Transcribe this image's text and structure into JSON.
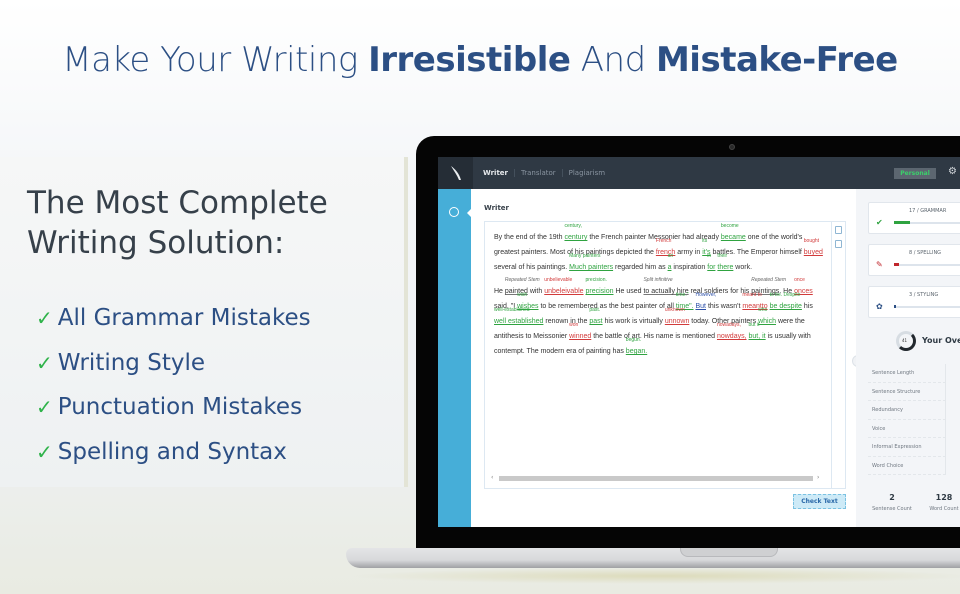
{
  "hero": {
    "headline_part1": "Make Your Writing ",
    "headline_bold1": "Irresistible",
    "headline_part2": " And ",
    "headline_bold2": "Mistake-Free"
  },
  "left_panel": {
    "title_line1": "The Most Complete",
    "title_line2": "Writing Solution:",
    "check_glyph": "✓",
    "features": [
      "All Grammar Mistakes",
      "Writing Style",
      "Punctuation Mistakes",
      "Spelling and Syntax"
    ]
  },
  "app": {
    "nav": [
      "Writer",
      "Translator",
      "Plagiarism"
    ],
    "plan_badge": "Personal",
    "section_title": "Writer",
    "check_button": "Check Text",
    "cards": [
      {
        "title": "17 / GRAMMAR",
        "icon": "abc-check-icon",
        "color": "#2fa340",
        "fill": 0.2
      },
      {
        "title": "8 / SPELLING",
        "icon": "spelling-icon",
        "color": "#c0262c",
        "fill": 0.06
      },
      {
        "title": "3 / STYLING",
        "icon": "styling-icon",
        "color": "#2b4f84",
        "fill": 0.02
      }
    ],
    "overall_score_value": "41",
    "overall_label": "Your Overall",
    "metrics": [
      "Sentence Length",
      "Sentence Structure",
      "Redundancy",
      "Voice",
      "Informal Expression",
      "Word Choice"
    ],
    "stats": [
      {
        "value": "2",
        "label": "Sentense Count"
      },
      {
        "value": "128",
        "label": "Word Count"
      }
    ]
  },
  "editor": {
    "p1": {
      "t1": "By the end of the 19th ",
      "w1": "century",
      "s1": "century,",
      "t2": " the French painter Messonier had already ",
      "w2": "became",
      "s2": "become",
      "t3": " one of the world's greatest painters. Most of his paintings depicted the ",
      "w3": "french",
      "s3": "French",
      "t4": " army in ",
      "w4": "it's",
      "s4": "its",
      "t5": " battles. The Emperor himself ",
      "w5": "buyed",
      "s5": "bought",
      "t6": " several of his paintings. ",
      "w6": "Much painters",
      "s6": "Many painters",
      "t7": " regarded him as ",
      "w7": "a",
      "s7": "an",
      "t8": " inspiration ",
      "w8": "for",
      "s8": "in",
      "t9": " ",
      "w9": "there",
      "s9": "their",
      "t10": " work."
    },
    "p2": {
      "t1": "He ",
      "w0": "painted",
      "s0": "Repeated Stem",
      "t1b": " with ",
      "w1": "unbeleivable",
      "s1": "unbelievable",
      "t2": " ",
      "w2": "precision",
      "s2": "precision.",
      "t3": " He used ",
      "w3": "to actually hire",
      "s3": "Split infinitive",
      "t4": " real soldiers for his ",
      "w4": "paintings",
      "s4": "Repeated Stem",
      "t5": ". He ",
      "w5": "onces",
      "s5": "once",
      "t6": " said, \"I ",
      "w6": "wishes",
      "s6": "wish",
      "t7": " to be remembered as the best painter of all ",
      "w7": "time\".",
      "s7": "time.\"",
      "t8": " ",
      "w8": "But",
      "s8": "However,",
      "t9": " this wasn't ",
      "w9": "meantto",
      "s9": "meant to",
      "t10": " ",
      "w10": "be despite",
      "s10": "to be. Despite",
      "t11": " his ",
      "w11": "well established",
      "s11": "well-established",
      "t12": " renown in the ",
      "w12": "past",
      "s12": "past.",
      "t13": " his work is virtually ",
      "w13": "unnown",
      "s13": "unknown",
      "t14": " today. Other painters ",
      "w14": "which",
      "s14": "who",
      "t15": " were the antithesis to Meissonier ",
      "w15": "winned",
      "s15": "won",
      "t16": " the battle of art. His name is mentioned ",
      "w16": "nowdays,",
      "s16": "nowadays,",
      "t17": " ",
      "w17": "but, it",
      "s17": "but it",
      "t18": " is usually with contempt. The modern era of painting has ",
      "w18": "began.",
      "s18": "begun."
    }
  }
}
